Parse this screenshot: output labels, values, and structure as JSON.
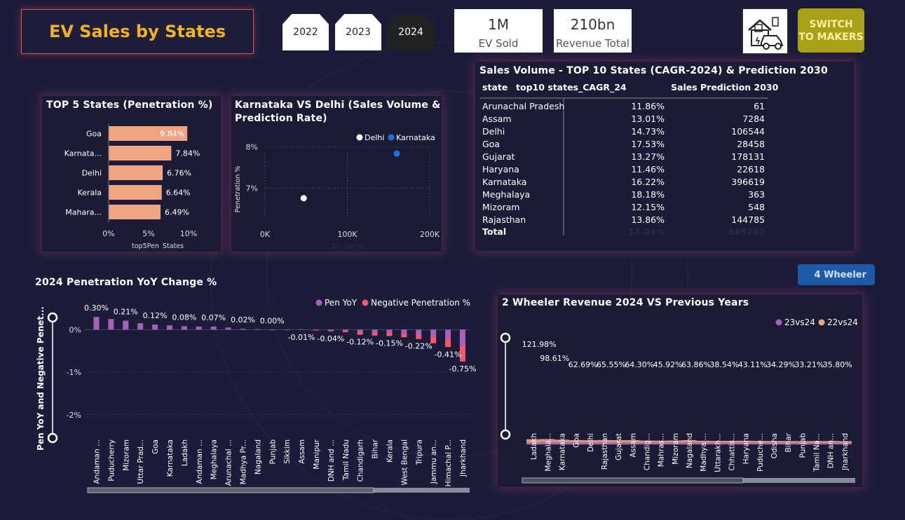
{
  "header": {
    "title": "EV Sales by States",
    "years": [
      "2022",
      "2023",
      "2024"
    ],
    "selected_year": "2024",
    "kpis": [
      {
        "value": "1M",
        "label": "EV Sold"
      },
      {
        "value": "210bn",
        "label": "Revenue Total"
      }
    ],
    "switch_label_line1": "SWITCH",
    "switch_label_line2": "TO MAKERS"
  },
  "wheel_toggle": {
    "label": "4 Wheeler"
  },
  "colors": {
    "bg": "#1c1c3a",
    "bar_peach": "#f0a484",
    "purple": "#a463b8",
    "red": "#f5576c",
    "dot_blue": "#1e6fe0",
    "accent_gold": "#f0b420"
  },
  "chart_data": [
    {
      "id": "top5",
      "type": "bar",
      "orientation": "horizontal",
      "title": "TOP 5 States (Penetration %)",
      "categories": [
        "Goa",
        "Karnata...",
        "Delhi",
        "Kerala",
        "Mahara..."
      ],
      "values": [
        9.84,
        7.84,
        6.76,
        6.64,
        6.49
      ],
      "data_labels": [
        "9.84%",
        "7.84%",
        "6.76%",
        "6.64%",
        "6.49%"
      ],
      "xlim": [
        0,
        10
      ],
      "xticks": [
        "0%",
        "5%",
        "10%"
      ],
      "xlabel": "top5Pen",
      "xlabel_suffix": "States"
    },
    {
      "id": "ka_dl",
      "type": "scatter",
      "title_line1": "Karnataka VS Delhi (Sales Volume &",
      "title_line2": "Prediction Rate)",
      "series": [
        {
          "name": "Delhi",
          "color": "#ffffff",
          "x": 47000,
          "y": 6.76
        },
        {
          "name": "Karnataka",
          "color": "#1e6fe0",
          "x": 160000,
          "y": 7.84
        }
      ],
      "xlim": [
        0,
        200000
      ],
      "ylim": [
        6.3,
        8.3
      ],
      "xticks": [
        {
          "v": 0,
          "label": "0K"
        },
        {
          "v": 100000,
          "label": "100K"
        },
        {
          "v": 200000,
          "label": "200K"
        }
      ],
      "yticks": [
        {
          "v": 7,
          "label": "7%"
        },
        {
          "v": 8,
          "label": "8%"
        }
      ],
      "ylabel": "Penetration %",
      "xlabel": "EV Sales"
    },
    {
      "id": "cagr_table",
      "type": "table",
      "title": "Sales Volume - TOP 10 States (CAGR-2024) & Prediction 2030",
      "columns": [
        "state",
        "top10 states_CAGR_24",
        "Sales Prediction 2030"
      ],
      "rows": [
        [
          "Arunachal Pradesh",
          "11.86%",
          "61"
        ],
        [
          "Assam",
          "13.01%",
          "7284"
        ],
        [
          "Delhi",
          "14.73%",
          "106544"
        ],
        [
          "Goa",
          "17.53%",
          "28458"
        ],
        [
          "Gujarat",
          "13.27%",
          "178131"
        ],
        [
          "Haryana",
          "11.46%",
          "22618"
        ],
        [
          "Karnataka",
          "16.22%",
          "396619"
        ],
        [
          "Meghalaya",
          "18.18%",
          "363"
        ],
        [
          "Mizoram",
          "12.15%",
          "548"
        ],
        [
          "Rajasthan",
          "13.86%",
          "144785"
        ]
      ],
      "total": [
        "Total",
        "14.04%",
        "846792"
      ]
    },
    {
      "id": "pen_yoy",
      "type": "bar",
      "title": "2024 Penetration YoY Change %",
      "ylabel": "Pen YoY and Negative Penet...",
      "series": [
        {
          "name": "Pen YoY",
          "color": "#a463b8"
        },
        {
          "name": "Negative Penetration %",
          "color": "#f5576c"
        }
      ],
      "categories": [
        "Andaman ...",
        "Puducherry",
        "Mizoram",
        "Uttar Prad...",
        "Goa",
        "Karnataka",
        "Ladakh",
        "Andaman ...",
        "Meghalaya",
        "Arunachal ...",
        "Madhya Pr...",
        "Nagaland",
        "Punjab",
        "Sikkim",
        "Assam",
        "Manipur",
        "DNH and ...",
        "Tamil Nadu",
        "Chandigarh",
        "Bihar",
        "Kerala",
        "West Bengal",
        "Tripura",
        "Jammu an...",
        "Himachal P...",
        "Jharkhand"
      ],
      "values": [
        0.3,
        0.25,
        0.21,
        0.15,
        0.12,
        0.1,
        0.08,
        0.07,
        0.07,
        0.05,
        0.02,
        0.01,
        0.0,
        0.0,
        -0.01,
        -0.02,
        -0.04,
        -0.06,
        -0.12,
        -0.14,
        -0.15,
        -0.18,
        -0.22,
        -0.32,
        -0.41,
        -0.75
      ],
      "data_labels": [
        {
          "i": 0,
          "text": "0.30%"
        },
        {
          "i": 2,
          "text": "0.21%"
        },
        {
          "i": 4,
          "text": "0.12%"
        },
        {
          "i": 6,
          "text": "0.08%"
        },
        {
          "i": 8,
          "text": "0.07%"
        },
        {
          "i": 10,
          "text": "0.02%"
        },
        {
          "i": 12,
          "text": "0.00%"
        },
        {
          "i": 14,
          "text": "-0.01%"
        },
        {
          "i": 16,
          "text": "-0.04%"
        },
        {
          "i": 18,
          "text": "-0.12%"
        },
        {
          "i": 20,
          "text": "-0.15%"
        },
        {
          "i": 22,
          "text": "-0.22%"
        },
        {
          "i": 24,
          "text": "-0.41%"
        },
        {
          "i": 25,
          "text": "-0.75%"
        }
      ],
      "ylim": [
        -2.3,
        0.5
      ],
      "yticks": [
        {
          "v": 0,
          "label": "0%"
        },
        {
          "v": -1,
          "label": "-1%"
        },
        {
          "v": -2,
          "label": "-2%"
        }
      ]
    },
    {
      "id": "rev2w",
      "type": "area",
      "title": "2 Wheeler Revenue 2024 VS Previous Years",
      "series": [
        {
          "name": "23vs24",
          "color": "#a463b8"
        },
        {
          "name": "22vs24",
          "color": "#f0a484"
        }
      ],
      "categories": [
        "Ladakh",
        "Meghala...",
        "Karnataka",
        "Goa",
        "Delhi",
        "Rajasthan",
        "Gujarat",
        "Assam",
        "Chandig...",
        "Mahras...",
        "Mizoram",
        "Nagaland",
        "Madhya ...",
        "Uttarakh...",
        "Chhattis...",
        "Haryana",
        "Puduche...",
        "Odisha",
        "Bihar",
        "Punjab",
        "Tamil Na...",
        "DNH an...",
        "Jharkhand"
      ],
      "values_22vs24": [
        121.98,
        98.61,
        80,
        62.69,
        60,
        65.55,
        62,
        64.3,
        50,
        45.92,
        52,
        63.86,
        45,
        38.54,
        40,
        43.11,
        36,
        34.29,
        33,
        33.21,
        32,
        35.8,
        30
      ],
      "values_23vs24": [
        10,
        40,
        30,
        28,
        25,
        30,
        26,
        24,
        20,
        18,
        22,
        24,
        16,
        14,
        15,
        16,
        13,
        12,
        12,
        11,
        10,
        11,
        10
      ],
      "data_labels": [
        {
          "i": 0,
          "text": "121.98%"
        },
        {
          "i": 1,
          "text": "98.61%"
        },
        {
          "i": 3,
          "text": "62.69%"
        },
        {
          "i": 5,
          "text": "65.55%"
        },
        {
          "i": 7,
          "text": "64.30%"
        },
        {
          "i": 9,
          "text": "45.92%"
        },
        {
          "i": 11,
          "text": "63.86%"
        },
        {
          "i": 13,
          "text": "38.54%"
        },
        {
          "i": 15,
          "text": "43.11%"
        },
        {
          "i": 17,
          "text": "34.29%"
        },
        {
          "i": 19,
          "text": "33.21%"
        },
        {
          "i": 21,
          "text": "35.80%"
        }
      ],
      "ylim": [
        -20,
        560
      ]
    }
  ]
}
